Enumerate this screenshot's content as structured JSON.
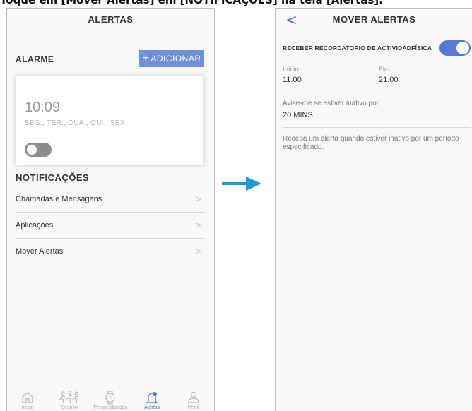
{
  "caption": "Toque em [Mover Alertas] em [NOTIFICAÇÕES] na tela [Alertas].",
  "left_screen": {
    "title": "ALERTAS",
    "alarm_section": "ALARME",
    "add_button": "ADICIONAR",
    "alarm": {
      "time": "10:09",
      "days": "SEG., TER., QUA., QUI., SEX.",
      "enabled": false
    },
    "notifications_section": "NOTIFICAÇÕES",
    "items": [
      {
        "label": "Chamadas e Mensagens"
      },
      {
        "label": "Aplicações"
      },
      {
        "label": "Mover Alertas"
      }
    ],
    "tabs": [
      {
        "label": "Início",
        "icon": "home-icon",
        "active": false
      },
      {
        "label": "Desafio",
        "icon": "runners-icon",
        "active": false
      },
      {
        "label": "Personalização",
        "icon": "watch-icon",
        "active": false
      },
      {
        "label": "Alertas",
        "icon": "bell-icon",
        "active": true
      },
      {
        "label": "Perfil",
        "icon": "person-icon",
        "active": false
      }
    ]
  },
  "right_screen": {
    "title": "MOVER ALERTAS",
    "toggle_label": "RECEBER RECORDATORIO DE ACTIVIDADFÍSICA",
    "toggle_enabled": true,
    "start_label": "Início",
    "start_value": "11:00",
    "end_label": "Fim",
    "end_value": "21:00",
    "inactive_label": "Avise-me se estiver inativo por",
    "inactive_value": "20 MINS",
    "description": "Receba um alerta quando estiver inativo por um período especificado."
  },
  "colors": {
    "accent": "#5679d4",
    "arrow": "#1a9ad6",
    "add_button": "#6f8fd6"
  }
}
